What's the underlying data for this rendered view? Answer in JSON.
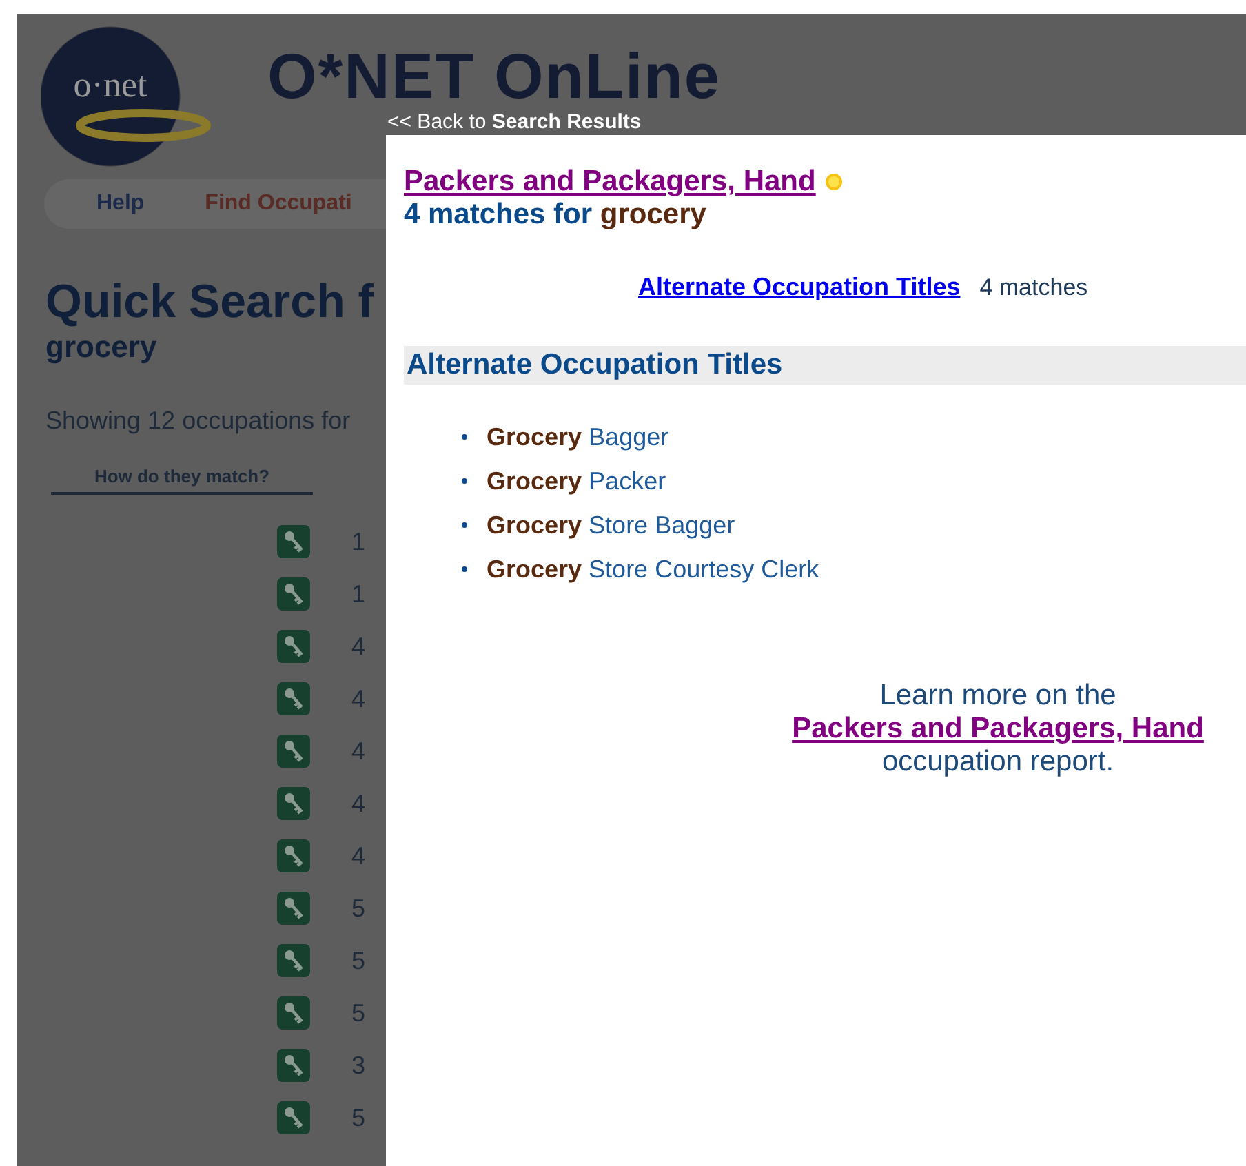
{
  "background_page": {
    "logo_text": "o·net",
    "site_title": "O*NET OnLine",
    "nav": [
      "Help",
      "Find Occupati"
    ],
    "heading": "Quick Search f",
    "query": "grocery",
    "summary": "Showing 12 occupations for",
    "column_header": "How do they match?",
    "rows": [
      {
        "code": "1"
      },
      {
        "code": "1"
      },
      {
        "code": "4"
      },
      {
        "code": "4"
      },
      {
        "code": "4"
      },
      {
        "code": "4"
      },
      {
        "code": "4"
      },
      {
        "code": "5"
      },
      {
        "code": "5"
      },
      {
        "code": "5"
      },
      {
        "code": "3"
      },
      {
        "code": "5"
      }
    ]
  },
  "back_link": "<< Back to **Search Results**",
  "modal": {
    "title": "Packers and Packagers, Hand",
    "subtitle": {
      "text": "4 matches for",
      "query": "grocery"
    },
    "jump_link": {
      "label": "Alternate Occupation Titles",
      "count": "4 matches"
    },
    "section": {
      "title": "Alternate Occupation Titles",
      "items": [
        "**Grocery** Bagger",
        "**Grocery** Packer",
        "**Grocery** Store Bagger",
        "**Grocery** Store Courtesy Clerk"
      ]
    },
    "footer": {
      "before": "Learn more on the",
      "link": "Packers and Packagers, Hand",
      "after": "occupation report."
    }
  }
}
